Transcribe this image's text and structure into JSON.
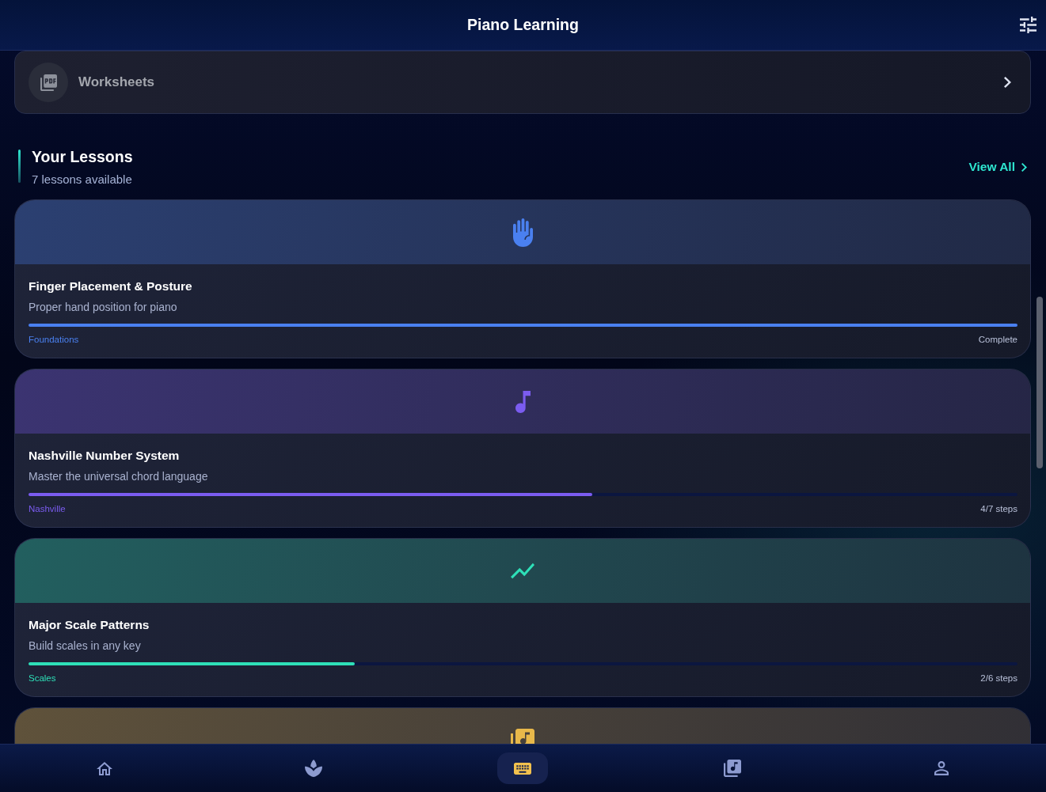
{
  "header": {
    "title": "Piano Learning"
  },
  "worksheets": {
    "label": "Worksheets"
  },
  "lessons": {
    "title": "Your Lessons",
    "subtitle": "7 lessons available",
    "view_all": "View All",
    "items": [
      {
        "title": "Finger Placement & Posture",
        "description": "Proper hand position for piano",
        "category": "Foundations",
        "status": "Complete",
        "level": 1,
        "color": "#4a80f0"
      },
      {
        "title": "Nashville Number System",
        "description": "Master the universal chord language",
        "category": "Nashville",
        "status": "4/7 steps",
        "level": 0.57,
        "color": "#7b5cf0"
      },
      {
        "title": "Major Scale Patterns",
        "description": "Build scales in any key",
        "category": "Scales",
        "status": "2/6 steps",
        "level": 0.33,
        "color": "#2ee0b8"
      },
      {
        "color": "#e8b84a"
      }
    ]
  },
  "bottom_nav": {
    "items": [
      {
        "selected": false
      },
      {
        "selected": false
      },
      {
        "selected": true
      },
      {
        "selected": false
      },
      {
        "selected": false
      }
    ]
  }
}
